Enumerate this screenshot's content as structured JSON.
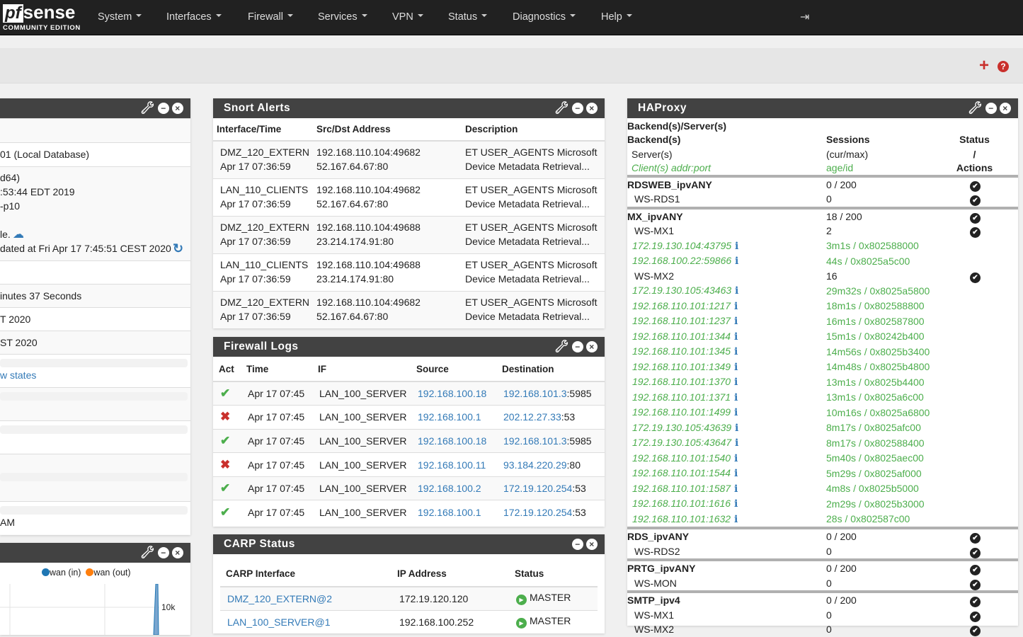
{
  "nav": {
    "logo": "pfsense",
    "logo_pf": "pf",
    "logo_sense": "sense",
    "edition": "COMMUNITY EDITION",
    "menus": [
      "System",
      "Interfaces",
      "Firewall",
      "Services",
      "VPN",
      "Status",
      "Diagnostics",
      "Help"
    ],
    "logout_icon": "sign-out-icon"
  },
  "toolbar": {
    "add_icon": "plus-icon",
    "help_icon": "question-circle-icon"
  },
  "sysinfo": {
    "rows": [
      "",
      "01 (Local Database)",
      "d64)\n:53:44 EDT 2019\n-p10\n\nle.\ndated at Fri Apr 17 7:45:51 CEST 2020",
      "",
      "inutes 37 Seconds",
      "T 2020",
      "ST 2020"
    ],
    "states_link": "w states",
    "last": "AM"
  },
  "traffic": {
    "legend": [
      "wan (in)",
      "wan (out)"
    ],
    "colors": [
      "#1f77b4",
      "#ff7f0e"
    ],
    "tick": "10k"
  },
  "snort": {
    "title": "Snort Alerts",
    "headers": [
      "Interface/Time",
      "Src/Dst Address",
      "Description"
    ],
    "rows": [
      [
        "DMZ_120_EXTERN",
        "Apr 17 07:36:59",
        "192.168.110.104:49682",
        "52.167.64.67:80",
        "ET USER_AGENTS Microsoft",
        "Device Metadata Retrieval..."
      ],
      [
        "LAN_110_CLIENTS",
        "Apr 17 07:36:59",
        "192.168.110.104:49682",
        "52.167.64.67:80",
        "ET USER_AGENTS Microsoft",
        "Device Metadata Retrieval..."
      ],
      [
        "DMZ_120_EXTERN",
        "Apr 17 07:36:59",
        "192.168.110.104:49688",
        "23.214.174.91:80",
        "ET USER_AGENTS Microsoft",
        "Device Metadata Retrieval..."
      ],
      [
        "LAN_110_CLIENTS",
        "Apr 17 07:36:59",
        "192.168.110.104:49688",
        "23.214.174.91:80",
        "ET USER_AGENTS Microsoft",
        "Device Metadata Retrieval..."
      ],
      [
        "DMZ_120_EXTERN",
        "Apr 17 07:36:59",
        "192.168.110.104:49682",
        "52.167.64.67:80",
        "ET USER_AGENTS Microsoft",
        "Device Metadata Retrieval..."
      ]
    ]
  },
  "fwlogs": {
    "title": "Firewall Logs",
    "headers": [
      "Act",
      "Time",
      "IF",
      "Source",
      "Destination"
    ],
    "rows": [
      [
        "pass",
        "Apr 17 07:45",
        "LAN_100_SERVER",
        "192.168.100.18",
        "192.168.101.3",
        "5985"
      ],
      [
        "block",
        "Apr 17 07:45",
        "LAN_100_SERVER",
        "192.168.100.1",
        "202.12.27.33",
        "53"
      ],
      [
        "pass",
        "Apr 17 07:45",
        "LAN_100_SERVER",
        "192.168.100.18",
        "192.168.101.3",
        "5985"
      ],
      [
        "block",
        "Apr 17 07:45",
        "LAN_100_SERVER",
        "192.168.100.11",
        "93.184.220.29",
        "80"
      ],
      [
        "pass",
        "Apr 17 07:45",
        "LAN_100_SERVER",
        "192.168.100.2",
        "172.19.120.254",
        "53"
      ],
      [
        "pass",
        "Apr 17 07:45",
        "LAN_100_SERVER",
        "192.168.100.1",
        "172.19.120.254",
        "53"
      ]
    ]
  },
  "carp": {
    "title": "CARP Status",
    "headers": [
      "CARP Interface",
      "IP Address",
      "Status"
    ],
    "rows": [
      [
        "DMZ_120_EXTERN@2",
        "172.19.120.120",
        "MASTER"
      ],
      [
        "LAN_100_SERVER@1",
        "192.168.100.252",
        "MASTER"
      ]
    ]
  },
  "haproxy": {
    "title": "HAProxy",
    "caption": "Backend(s)/Server(s)",
    "head": [
      [
        "Backend(s)",
        "Sessions",
        "Status"
      ],
      [
        "Server(s)",
        "(cur/max)",
        "/"
      ],
      [
        "Client(s) addr:port",
        "age/id",
        "Actions"
      ]
    ],
    "rows": [
      [
        "b",
        "RDSWEB_ipvANY",
        "0 / 200",
        true
      ],
      [
        "s",
        "WS-RDS1",
        "0",
        true
      ],
      [
        "b",
        "MX_ipvANY",
        "18 / 200",
        true
      ],
      [
        "s",
        "WS-MX1",
        "2",
        true
      ],
      [
        "c",
        "172.19.130.104:43795",
        "3m1s / 0x802588000"
      ],
      [
        "c",
        "192.168.100.22:59866",
        "44s / 0x8025a5c00"
      ],
      [
        "s",
        "WS-MX2",
        "16",
        true
      ],
      [
        "c",
        "172.19.130.105:43463",
        "29m32s / 0x8025a5800"
      ],
      [
        "c",
        "192.168.110.101:1217",
        "18m1s / 0x802588800"
      ],
      [
        "c",
        "192.168.110.101:1237",
        "16m1s / 0x802587800"
      ],
      [
        "c",
        "192.168.110.101:1344",
        "15m1s / 0x80242b400"
      ],
      [
        "c",
        "192.168.110.101:1345",
        "14m56s / 0x8025b3400"
      ],
      [
        "c",
        "192.168.110.101:1349",
        "14m48s / 0x8025b4800"
      ],
      [
        "c",
        "192.168.110.101:1370",
        "13m1s / 0x8025b4400"
      ],
      [
        "c",
        "192.168.110.101:1371",
        "13m1s / 0x8025a6c00"
      ],
      [
        "c",
        "192.168.110.101:1499",
        "10m16s / 0x8025a6800"
      ],
      [
        "c",
        "172.19.130.105:43639",
        "8m17s / 0x8025afc00"
      ],
      [
        "c",
        "172.19.130.105:43647",
        "8m17s / 0x802588400"
      ],
      [
        "c",
        "192.168.110.101:1540",
        "5m40s / 0x8025aec00"
      ],
      [
        "c",
        "192.168.110.101:1544",
        "5m29s / 0x8025af000"
      ],
      [
        "c",
        "192.168.110.101:1587",
        "4m8s / 0x8025b5000"
      ],
      [
        "c",
        "192.168.110.101:1616",
        "2m29s / 0x8025b3000"
      ],
      [
        "c",
        "192.168.110.101:1632",
        "28s / 0x802587c00"
      ],
      [
        "b",
        "RDS_ipvANY",
        "0 / 200",
        true
      ],
      [
        "s",
        "WS-RDS2",
        "0",
        true
      ],
      [
        "b",
        "PRTG_ipvANY",
        "0 / 200",
        true
      ],
      [
        "s",
        "WS-MON",
        "0",
        true
      ],
      [
        "b",
        "SMTP_ipv4",
        "0 / 200",
        true
      ],
      [
        "s",
        "WS-MX1",
        "0",
        true
      ],
      [
        "s",
        "WS-MX2",
        "0",
        true
      ]
    ]
  }
}
